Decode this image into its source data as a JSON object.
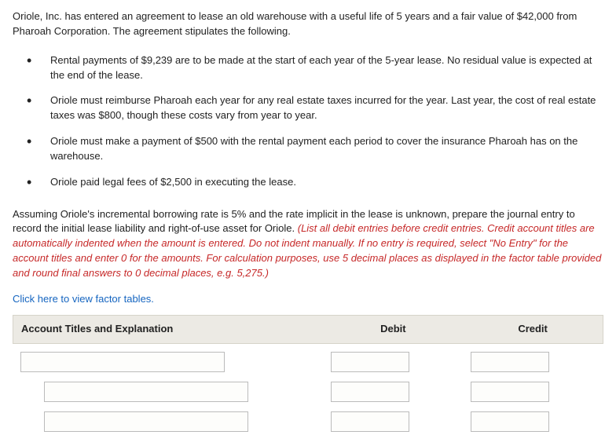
{
  "intro": "Oriole, Inc. has entered an agreement to lease an old warehouse with a useful life of 5 years and a fair value of $42,000 from Pharoah Corporation. The agreement stipulates the following.",
  "bullets": [
    "Rental payments of $9,239 are to be made at the start of each year of the 5-year lease. No residual value is expected at the end of the lease.",
    "Oriole must reimburse Pharoah each year for any real estate taxes incurred for the year. Last year, the cost of real estate taxes was $800, though these costs vary from year to year.",
    "Oriole must make a payment of $500 with the rental payment each period to cover the insurance Pharoah has on the warehouse.",
    "Oriole paid legal fees of $2,500 in executing the lease."
  ],
  "assume_plain": "Assuming Oriole's incremental borrowing rate is 5% and the rate implicit in the lease is unknown, prepare the journal entry to record the initial lease liability and right-of-use asset for Oriole. ",
  "assume_red": "(List all debit entries before credit entries. Credit account titles are automatically indented when the amount is entered. Do not indent manually. If no entry is required, select \"No Entry\" for the account titles and enter 0 for the amounts. For calculation purposes, use 5 decimal places as displayed in the factor table provided and round final answers to 0 decimal places, e.g. 5,275.)",
  "link_text": "Click here to view factor tables.",
  "headers": {
    "account": "Account Titles and Explanation",
    "debit": "Debit",
    "credit": "Credit"
  },
  "rows": [
    {
      "account": "",
      "debit": "",
      "credit": ""
    },
    {
      "account": "",
      "debit": "",
      "credit": ""
    },
    {
      "account": "",
      "debit": "",
      "credit": ""
    }
  ]
}
